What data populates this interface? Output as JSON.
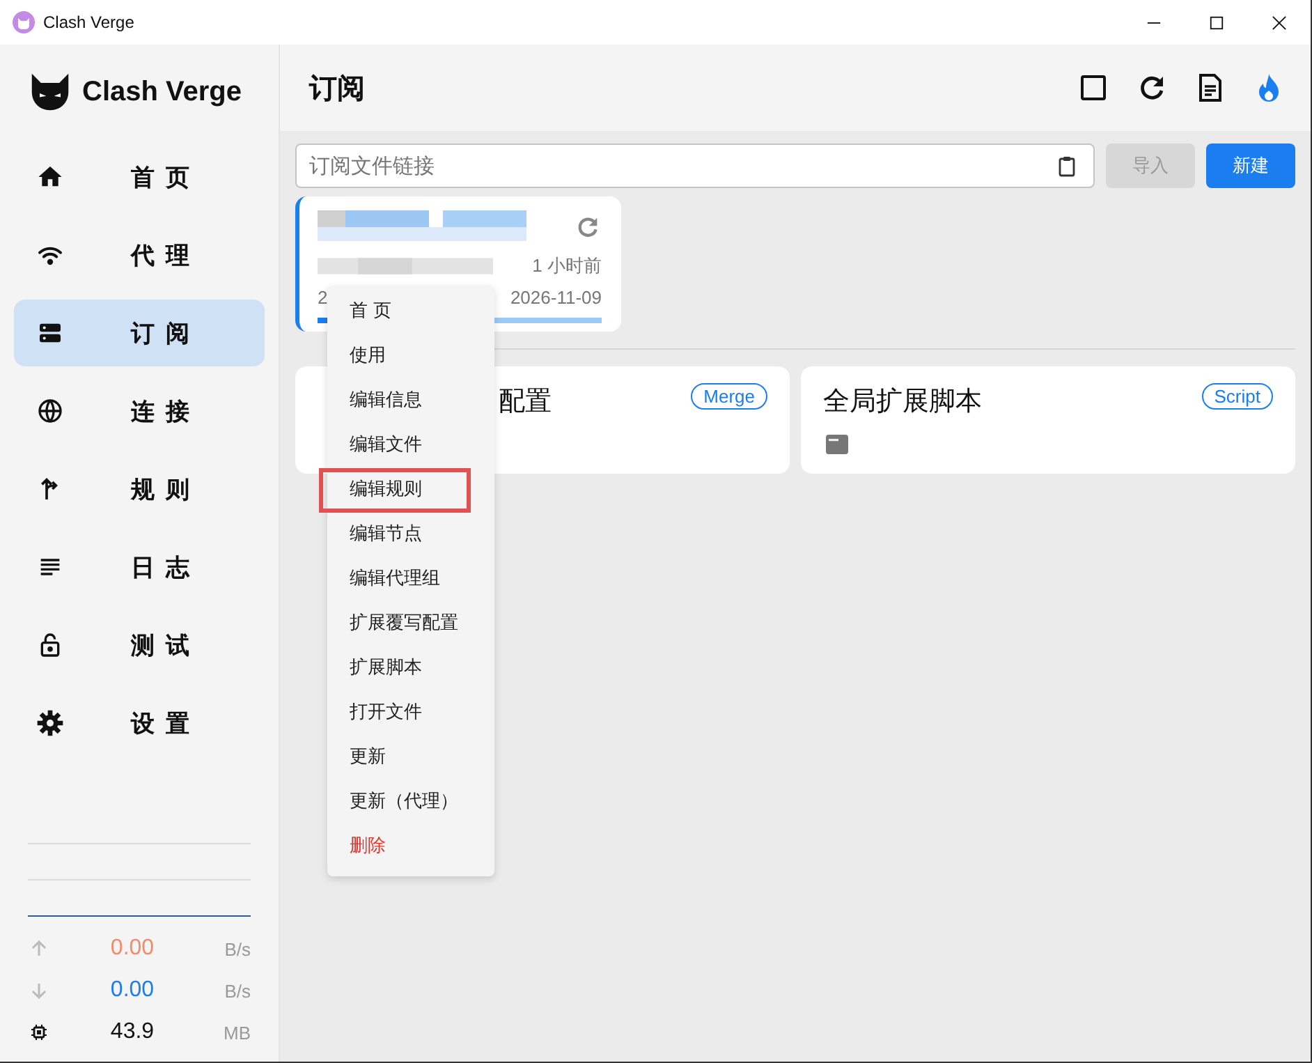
{
  "window": {
    "title": "Clash Verge"
  },
  "sidebar": {
    "logo": "Clash Verge",
    "items": [
      {
        "label": "首 页",
        "selected": false
      },
      {
        "label": "代 理",
        "selected": false
      },
      {
        "label": "订 阅",
        "selected": true
      },
      {
        "label": "连 接",
        "selected": false
      },
      {
        "label": "规 则",
        "selected": false
      },
      {
        "label": "日 志",
        "selected": false
      },
      {
        "label": "测 试",
        "selected": false
      },
      {
        "label": "设 置",
        "selected": false
      }
    ],
    "traffic": [
      {
        "kind": "up",
        "value": "0.00",
        "unit": "B/s",
        "color": "#f28b6a"
      },
      {
        "kind": "down",
        "value": "0.00",
        "unit": "B/s",
        "color": "#1a7df0"
      },
      {
        "kind": "memory",
        "value": "43.9",
        "unit": "MB",
        "color": "#111111"
      }
    ]
  },
  "header": {
    "title": "订阅"
  },
  "url_field": {
    "placeholder": "订阅文件链接"
  },
  "buttons": [
    {
      "label": "导入",
      "disabled": true
    },
    {
      "label": "新建",
      "disabled": false
    }
  ],
  "profile": {
    "selected": true,
    "updated": "1 小时前",
    "date_start": "2",
    "expire": "2026-11-09",
    "level": 0.1
  },
  "cards": [
    {
      "title_parts": [
        "配置"
      ],
      "tag": "Merge",
      "has_file_icon": false
    },
    {
      "title_parts": [
        "全局扩展脚本"
      ],
      "tag": "Script",
      "has_file_icon": true
    }
  ],
  "context_menu": [
    {
      "label": "首 页",
      "kind": "normal",
      "highlighted": false
    },
    {
      "label": "使用",
      "kind": "normal",
      "highlighted": false
    },
    {
      "label": "编辑信息",
      "kind": "normal",
      "highlighted": false
    },
    {
      "label": "编辑文件",
      "kind": "normal",
      "highlighted": false
    },
    {
      "label": "编辑规则",
      "kind": "normal",
      "highlighted": true
    },
    {
      "label": "编辑节点",
      "kind": "normal",
      "highlighted": false
    },
    {
      "label": "编辑代理组",
      "kind": "normal",
      "highlighted": false
    },
    {
      "label": "扩展覆写配置",
      "kind": "normal",
      "highlighted": false
    },
    {
      "label": "扩展脚本",
      "kind": "normal",
      "highlighted": false
    },
    {
      "label": "打开文件",
      "kind": "normal",
      "highlighted": false
    },
    {
      "label": "更新",
      "kind": "normal",
      "highlighted": false
    },
    {
      "label": "更新（代理）",
      "kind": "normal",
      "highlighted": false
    },
    {
      "label": "删除",
      "kind": "danger",
      "highlighted": false
    }
  ]
}
